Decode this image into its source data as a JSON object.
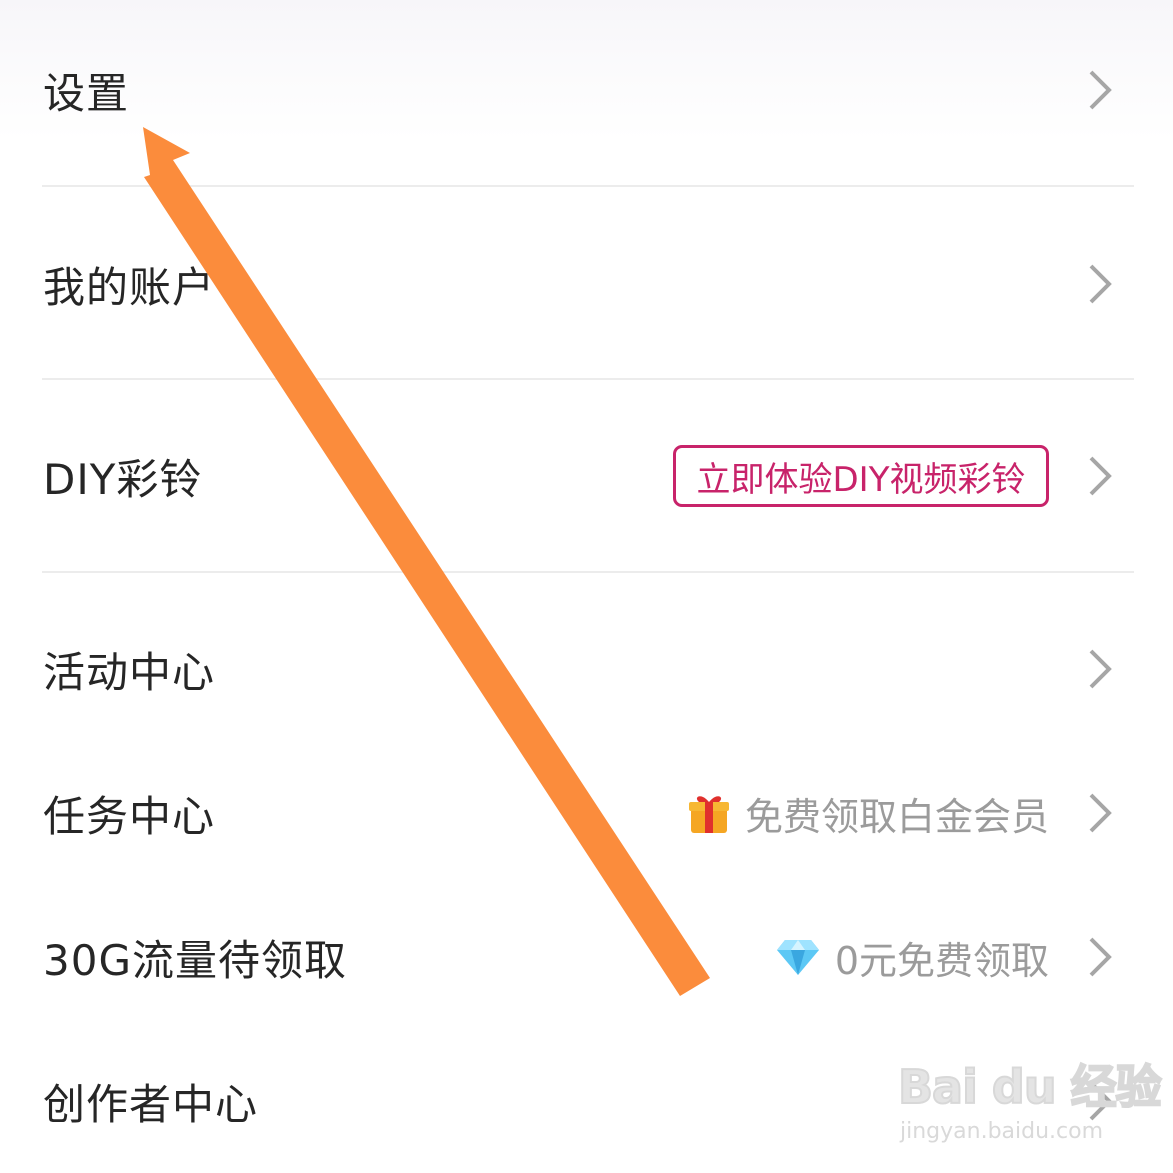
{
  "menu": {
    "items": [
      {
        "label": "设置"
      },
      {
        "label": "我的账户"
      },
      {
        "label": "DIY彩铃",
        "badge": "立即体验DIY视频彩铃"
      },
      {
        "label": "活动中心"
      },
      {
        "label": "任务中心",
        "hint": "免费领取白金会员",
        "hint_icon": "gift-icon"
      },
      {
        "label": "30G流量待领取",
        "hint": "0元免费领取",
        "hint_icon": "diamond-icon"
      },
      {
        "label": "创作者中心"
      }
    ]
  },
  "watermark": {
    "logo": "Bai du 经验",
    "url": "jingyan.baidu.com"
  },
  "colors": {
    "text": "#262626",
    "accent": "#c8236a",
    "hint": "#9b9b9b",
    "chevron": "#a6a6a6",
    "arrow": "#fb8c3c",
    "divider": "#ececec"
  }
}
